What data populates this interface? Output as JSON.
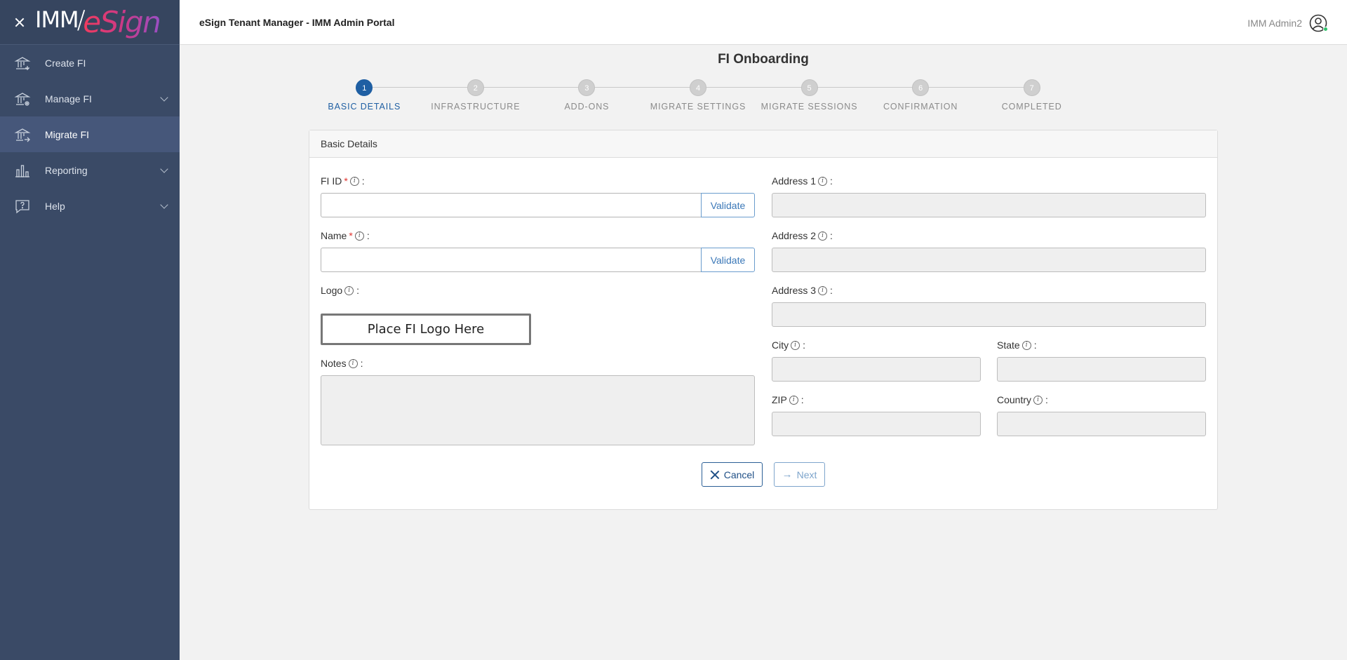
{
  "sidebar": {
    "brand_imm": "IMM",
    "brand_esign": "eSign",
    "items": [
      {
        "label": "Create FI",
        "icon": "bank-add-icon"
      },
      {
        "label": "Manage FI",
        "icon": "bank-gear-icon"
      },
      {
        "label": "Migrate FI",
        "icon": "bank-migrate-icon"
      },
      {
        "label": "Reporting",
        "icon": "bar-chart-icon"
      },
      {
        "label": "Help",
        "icon": "help-chat-icon"
      }
    ]
  },
  "header": {
    "title": "eSign Tenant Manager - IMM Admin Portal",
    "user_name": "IMM Admin2"
  },
  "page": {
    "title": "FI Onboarding"
  },
  "stepper": {
    "steps": [
      {
        "num": "1",
        "label": "BASIC DETAILS"
      },
      {
        "num": "2",
        "label": "INFRASTRUCTURE"
      },
      {
        "num": "3",
        "label": "ADD-ONS"
      },
      {
        "num": "4",
        "label": "MIGRATE SETTINGS"
      },
      {
        "num": "5",
        "label": "MIGRATE SESSIONS"
      },
      {
        "num": "6",
        "label": "CONFIRMATION"
      },
      {
        "num": "7",
        "label": "COMPLETED"
      }
    ],
    "active_step": 1
  },
  "form": {
    "section_title": "Basic Details",
    "fi_id_label": "FI ID",
    "name_label": "Name",
    "logo_label": "Logo",
    "logo_placeholder": "Place FI Logo Here",
    "notes_label": "Notes",
    "address1_label": "Address 1",
    "address2_label": "Address 2",
    "address3_label": "Address 3",
    "city_label": "City",
    "state_label": "State",
    "zip_label": "ZIP",
    "country_label": "Country",
    "required_mark": "*",
    "info_glyph": "i",
    "colon": ":",
    "validate_label": "Validate",
    "fi_id_value": "",
    "name_value": ""
  },
  "actions": {
    "cancel_label": "Cancel",
    "next_label": "Next"
  }
}
